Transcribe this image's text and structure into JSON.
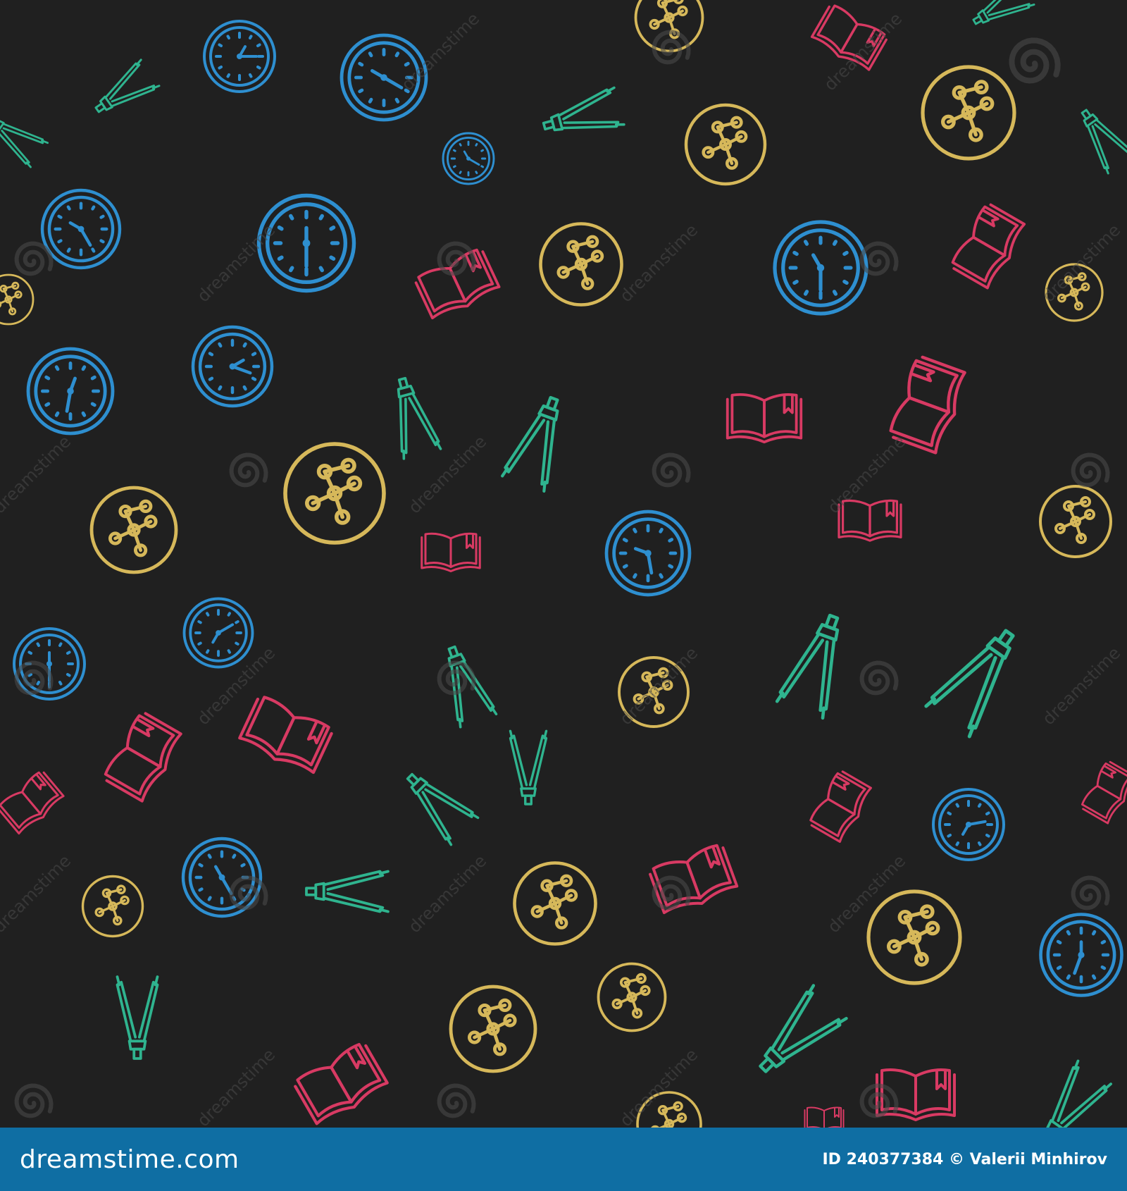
{
  "image": {
    "kind": "seamless pattern of line icons on dark background",
    "background_color": "#202020",
    "icon_colors": {
      "clock": "#2e8fd0",
      "compass_tool": "#2fb48f",
      "molecule_circle": "#d6b85a",
      "book": "#d83a63",
      "watermark": "#4a4a4a"
    },
    "icon_types": [
      "clock-icon",
      "drawing-compass-icon",
      "molecule-circle-icon",
      "open-book-icon",
      "watermark-spiral-icon"
    ]
  },
  "watermark_text": "dreamstime",
  "footer": {
    "background": "#0f6ea3",
    "logo": "dreamstime.com",
    "credit": "ID 240377384 © Valerii Minhirov"
  }
}
